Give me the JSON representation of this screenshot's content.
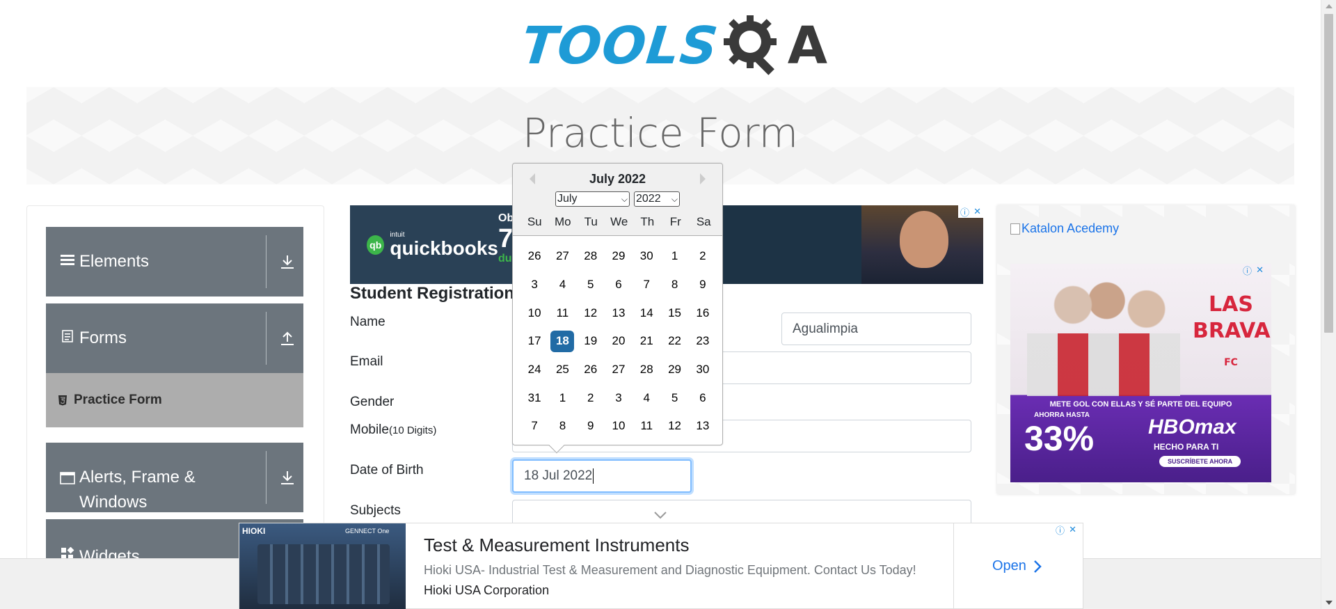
{
  "header": {
    "logo_text": "TOOLS",
    "logo_suffix": "A"
  },
  "banner": {
    "title": "Practice Form"
  },
  "sidebar": {
    "groups": [
      {
        "label": "Elements",
        "icon": "hamburger-icon",
        "arrow": "download-icon"
      },
      {
        "label": "Forms",
        "icon": "document-icon",
        "arrow": "upload-icon"
      },
      {
        "label": "Alerts, Frame &",
        "label2": "Windows",
        "icon": "window-icon",
        "arrow": "download-icon"
      },
      {
        "label": "Widgets",
        "icon": "widgets-icon"
      }
    ],
    "active_item": {
      "label": "Practice Form",
      "icon": "html5-icon"
    }
  },
  "ad_top": {
    "brand": "quickbooks",
    "brand_prefix": "intuit",
    "fragment_top": "Obt",
    "fragment_mid": "7",
    "fragment_bottom": "dur"
  },
  "form": {
    "title": "Student Registration",
    "labels": {
      "name": "Name",
      "email": "Email",
      "gender": "Gender",
      "mobile": "Mobile",
      "mobile_hint": "(10 Digits)",
      "dob": "Date of Birth",
      "subjects": "Subjects"
    },
    "last_name_value": "Agualimpia",
    "dob_value": "18 Jul 2022"
  },
  "datepicker": {
    "month_title": "July 2022",
    "month_select": "July",
    "year_select": "2022",
    "weekdays": [
      "Su",
      "Mo",
      "Tu",
      "We",
      "Th",
      "Fr",
      "Sa"
    ],
    "weeks": [
      [
        "26",
        "27",
        "28",
        "29",
        "30",
        "1",
        "2"
      ],
      [
        "3",
        "4",
        "5",
        "6",
        "7",
        "8",
        "9"
      ],
      [
        "10",
        "11",
        "12",
        "13",
        "14",
        "15",
        "16"
      ],
      [
        "17",
        "18",
        "19",
        "20",
        "21",
        "22",
        "23"
      ],
      [
        "24",
        "25",
        "26",
        "27",
        "28",
        "29",
        "30"
      ],
      [
        "31",
        "1",
        "2",
        "3",
        "4",
        "5",
        "6"
      ],
      [
        "7",
        "8",
        "9",
        "10",
        "11",
        "12",
        "13"
      ]
    ],
    "selected": "18"
  },
  "ad_right": {
    "katalon_alt": "Katalon Acedemy",
    "show_title": "LAS BRAVAS",
    "show_sub": "FC",
    "promo": "METE GOL CON ELLAS Y SÉ PARTE DEL EQUIPO",
    "discount_label": "AHORRA HASTA",
    "discount": "33%",
    "brand": "HBOmax",
    "tagline": "HECHO PARA TI",
    "cta": "SUSCRÍBETE AHORA"
  },
  "ad_bottom": {
    "image_brand": "HIOKI",
    "image_badge": "GENNECT One",
    "title": "Test & Measurement Instruments",
    "description": "Hioki USA- Industrial Test & Measurement and Diagnostic Equipment. Contact Us Today!",
    "advertiser": "Hioki USA Corporation",
    "cta": "Open"
  },
  "colors": {
    "nav_bg": "#6c757d",
    "active_bg": "#adadad",
    "accent": "#216ba5",
    "logo_blue": "#1e9bd6"
  }
}
